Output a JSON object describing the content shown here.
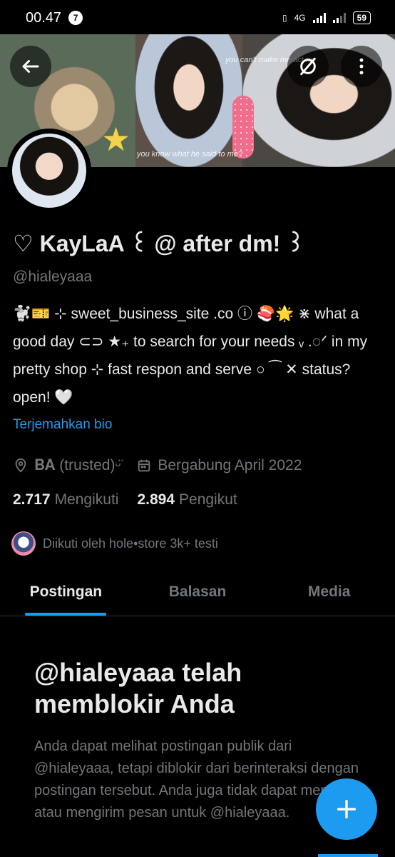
{
  "status_bar": {
    "time": "00.47",
    "notification_count": "7",
    "network": "4G",
    "battery": "59"
  },
  "banner": {
    "overlay_text_1": "you can't make me act ne",
    "overlay_text_2": "you know what he said to me?"
  },
  "profile": {
    "display_name": "♡ KayLaA ꒰ @ after dm! ꒱",
    "handle": "@hialeyaaa",
    "bio": "🐩🎫 ⊹ sweet_business_site .co ⓘ 🍣🌟 ⋇ what a good day ⊂⊃ ★₊ to search for your needs ᵥ .◌ᐟ in my pretty shop ⊹ fast respon and serve ○ ⁀ ✕ status? open! 🤍",
    "translate_bio_label": "Terjemahkan bio",
    "location": "𝐁𝐀 (trusted)ᵕ̈",
    "joined": "Bergabung April 2022",
    "following_count": "2.717",
    "following_label": "Mengikuti",
    "followers_count": "2.894",
    "followers_label": "Pengikut",
    "followed_by": "Diikuti oleh hole•store 3k+ testi"
  },
  "tabs": [
    {
      "label": "Postingan",
      "active": true
    },
    {
      "label": "Balasan",
      "active": false
    },
    {
      "label": "Media",
      "active": false
    }
  ],
  "blocked": {
    "title": "@hialeyaaa telah memblokir Anda",
    "body": "Anda dapat melihat postingan publik dari @hialeyaaa, tetapi diblokir dari berinteraksi dengan postingan tersebut. Anda juga tidak dapat mengikuti atau mengirim pesan untuk @hialeyaaa."
  },
  "icons": {
    "back": "arrow-left-icon",
    "hide": "eye-off-icon",
    "more": "more-vertical-icon",
    "location": "location-pin-icon",
    "calendar": "calendar-icon",
    "compose": "plus-icon"
  },
  "colors": {
    "accent": "#1d9bf0",
    "background": "#000000",
    "text": "#e7e9ea",
    "muted": "#71767b"
  }
}
